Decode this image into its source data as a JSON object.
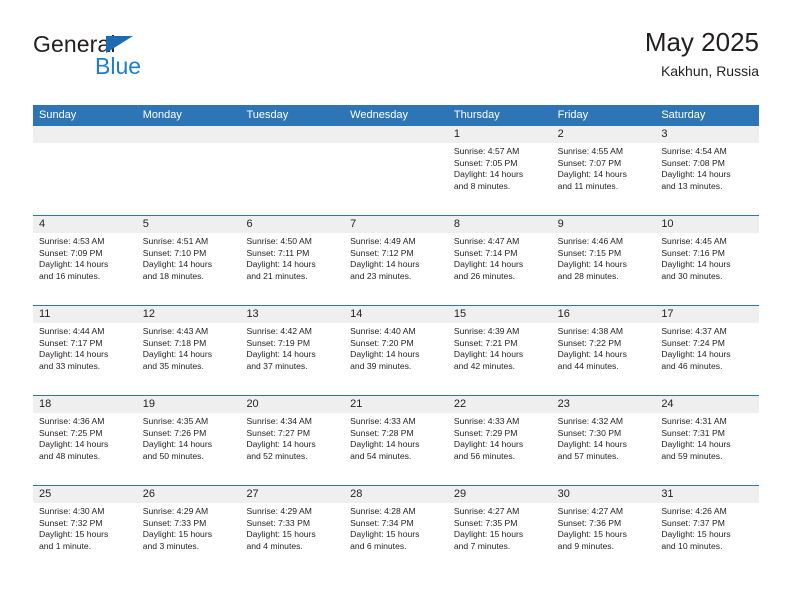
{
  "brand": {
    "name_top": "General",
    "name_bottom": "Blue",
    "accent_color": "#1b7fd1",
    "triangle_color": "#1b6cb3"
  },
  "header": {
    "title": "May 2025",
    "subtitle": "Kakhun, Russia"
  },
  "theme": {
    "header_bar_color": "#2e75b6",
    "daynum_band_color": "#efefef",
    "text_color": "#231f20"
  },
  "weekday_headers": [
    "Sunday",
    "Monday",
    "Tuesday",
    "Wednesday",
    "Thursday",
    "Friday",
    "Saturday"
  ],
  "labels": {
    "sunrise_prefix": "Sunrise:",
    "sunset_prefix": "Sunset:",
    "daylight_prefix": "Daylight:"
  },
  "weeks": [
    [
      {
        "day": "",
        "empty": true
      },
      {
        "day": "",
        "empty": true
      },
      {
        "day": "",
        "empty": true
      },
      {
        "day": "",
        "empty": true
      },
      {
        "day": "1",
        "sunrise": "Sunrise: 4:57 AM",
        "sunset": "Sunset: 7:05 PM",
        "daylight_line1": "Daylight: 14 hours",
        "daylight_line2": "and 8 minutes."
      },
      {
        "day": "2",
        "sunrise": "Sunrise: 4:55 AM",
        "sunset": "Sunset: 7:07 PM",
        "daylight_line1": "Daylight: 14 hours",
        "daylight_line2": "and 11 minutes."
      },
      {
        "day": "3",
        "sunrise": "Sunrise: 4:54 AM",
        "sunset": "Sunset: 7:08 PM",
        "daylight_line1": "Daylight: 14 hours",
        "daylight_line2": "and 13 minutes."
      }
    ],
    [
      {
        "day": "4",
        "sunrise": "Sunrise: 4:53 AM",
        "sunset": "Sunset: 7:09 PM",
        "daylight_line1": "Daylight: 14 hours",
        "daylight_line2": "and 16 minutes."
      },
      {
        "day": "5",
        "sunrise": "Sunrise: 4:51 AM",
        "sunset": "Sunset: 7:10 PM",
        "daylight_line1": "Daylight: 14 hours",
        "daylight_line2": "and 18 minutes."
      },
      {
        "day": "6",
        "sunrise": "Sunrise: 4:50 AM",
        "sunset": "Sunset: 7:11 PM",
        "daylight_line1": "Daylight: 14 hours",
        "daylight_line2": "and 21 minutes."
      },
      {
        "day": "7",
        "sunrise": "Sunrise: 4:49 AM",
        "sunset": "Sunset: 7:12 PM",
        "daylight_line1": "Daylight: 14 hours",
        "daylight_line2": "and 23 minutes."
      },
      {
        "day": "8",
        "sunrise": "Sunrise: 4:47 AM",
        "sunset": "Sunset: 7:14 PM",
        "daylight_line1": "Daylight: 14 hours",
        "daylight_line2": "and 26 minutes."
      },
      {
        "day": "9",
        "sunrise": "Sunrise: 4:46 AM",
        "sunset": "Sunset: 7:15 PM",
        "daylight_line1": "Daylight: 14 hours",
        "daylight_line2": "and 28 minutes."
      },
      {
        "day": "10",
        "sunrise": "Sunrise: 4:45 AM",
        "sunset": "Sunset: 7:16 PM",
        "daylight_line1": "Daylight: 14 hours",
        "daylight_line2": "and 30 minutes."
      }
    ],
    [
      {
        "day": "11",
        "sunrise": "Sunrise: 4:44 AM",
        "sunset": "Sunset: 7:17 PM",
        "daylight_line1": "Daylight: 14 hours",
        "daylight_line2": "and 33 minutes."
      },
      {
        "day": "12",
        "sunrise": "Sunrise: 4:43 AM",
        "sunset": "Sunset: 7:18 PM",
        "daylight_line1": "Daylight: 14 hours",
        "daylight_line2": "and 35 minutes."
      },
      {
        "day": "13",
        "sunrise": "Sunrise: 4:42 AM",
        "sunset": "Sunset: 7:19 PM",
        "daylight_line1": "Daylight: 14 hours",
        "daylight_line2": "and 37 minutes."
      },
      {
        "day": "14",
        "sunrise": "Sunrise: 4:40 AM",
        "sunset": "Sunset: 7:20 PM",
        "daylight_line1": "Daylight: 14 hours",
        "daylight_line2": "and 39 minutes."
      },
      {
        "day": "15",
        "sunrise": "Sunrise: 4:39 AM",
        "sunset": "Sunset: 7:21 PM",
        "daylight_line1": "Daylight: 14 hours",
        "daylight_line2": "and 42 minutes."
      },
      {
        "day": "16",
        "sunrise": "Sunrise: 4:38 AM",
        "sunset": "Sunset: 7:22 PM",
        "daylight_line1": "Daylight: 14 hours",
        "daylight_line2": "and 44 minutes."
      },
      {
        "day": "17",
        "sunrise": "Sunrise: 4:37 AM",
        "sunset": "Sunset: 7:24 PM",
        "daylight_line1": "Daylight: 14 hours",
        "daylight_line2": "and 46 minutes."
      }
    ],
    [
      {
        "day": "18",
        "sunrise": "Sunrise: 4:36 AM",
        "sunset": "Sunset: 7:25 PM",
        "daylight_line1": "Daylight: 14 hours",
        "daylight_line2": "and 48 minutes."
      },
      {
        "day": "19",
        "sunrise": "Sunrise: 4:35 AM",
        "sunset": "Sunset: 7:26 PM",
        "daylight_line1": "Daylight: 14 hours",
        "daylight_line2": "and 50 minutes."
      },
      {
        "day": "20",
        "sunrise": "Sunrise: 4:34 AM",
        "sunset": "Sunset: 7:27 PM",
        "daylight_line1": "Daylight: 14 hours",
        "daylight_line2": "and 52 minutes."
      },
      {
        "day": "21",
        "sunrise": "Sunrise: 4:33 AM",
        "sunset": "Sunset: 7:28 PM",
        "daylight_line1": "Daylight: 14 hours",
        "daylight_line2": "and 54 minutes."
      },
      {
        "day": "22",
        "sunrise": "Sunrise: 4:33 AM",
        "sunset": "Sunset: 7:29 PM",
        "daylight_line1": "Daylight: 14 hours",
        "daylight_line2": "and 56 minutes."
      },
      {
        "day": "23",
        "sunrise": "Sunrise: 4:32 AM",
        "sunset": "Sunset: 7:30 PM",
        "daylight_line1": "Daylight: 14 hours",
        "daylight_line2": "and 57 minutes."
      },
      {
        "day": "24",
        "sunrise": "Sunrise: 4:31 AM",
        "sunset": "Sunset: 7:31 PM",
        "daylight_line1": "Daylight: 14 hours",
        "daylight_line2": "and 59 minutes."
      }
    ],
    [
      {
        "day": "25",
        "sunrise": "Sunrise: 4:30 AM",
        "sunset": "Sunset: 7:32 PM",
        "daylight_line1": "Daylight: 15 hours",
        "daylight_line2": "and 1 minute."
      },
      {
        "day": "26",
        "sunrise": "Sunrise: 4:29 AM",
        "sunset": "Sunset: 7:33 PM",
        "daylight_line1": "Daylight: 15 hours",
        "daylight_line2": "and 3 minutes."
      },
      {
        "day": "27",
        "sunrise": "Sunrise: 4:29 AM",
        "sunset": "Sunset: 7:33 PM",
        "daylight_line1": "Daylight: 15 hours",
        "daylight_line2": "and 4 minutes."
      },
      {
        "day": "28",
        "sunrise": "Sunrise: 4:28 AM",
        "sunset": "Sunset: 7:34 PM",
        "daylight_line1": "Daylight: 15 hours",
        "daylight_line2": "and 6 minutes."
      },
      {
        "day": "29",
        "sunrise": "Sunrise: 4:27 AM",
        "sunset": "Sunset: 7:35 PM",
        "daylight_line1": "Daylight: 15 hours",
        "daylight_line2": "and 7 minutes."
      },
      {
        "day": "30",
        "sunrise": "Sunrise: 4:27 AM",
        "sunset": "Sunset: 7:36 PM",
        "daylight_line1": "Daylight: 15 hours",
        "daylight_line2": "and 9 minutes."
      },
      {
        "day": "31",
        "sunrise": "Sunrise: 4:26 AM",
        "sunset": "Sunset: 7:37 PM",
        "daylight_line1": "Daylight: 15 hours",
        "daylight_line2": "and 10 minutes."
      }
    ]
  ]
}
